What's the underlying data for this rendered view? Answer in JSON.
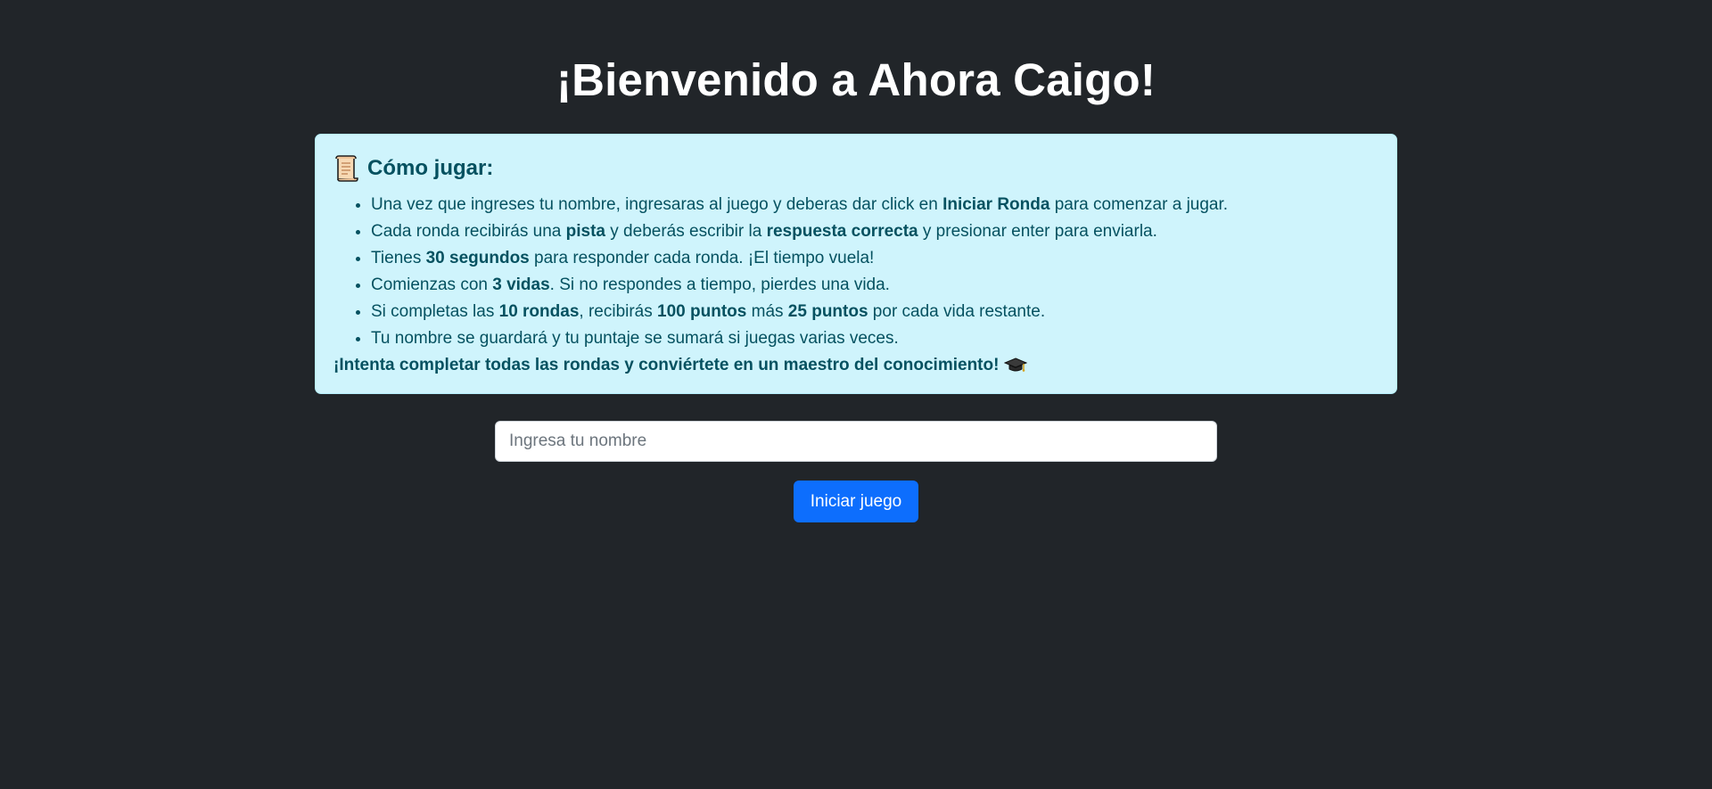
{
  "header": {
    "title": "¡Bienvenido a Ahora Caigo!"
  },
  "instructions": {
    "icon": "scroll-icon",
    "title": "Cómo jugar:",
    "rules": [
      [
        {
          "text": "Una vez que ingreses tu nombre, ingresaras al juego y deberas dar click en ",
          "bold": false
        },
        {
          "text": "Iniciar Ronda",
          "bold": true
        },
        {
          "text": " para comenzar a jugar.",
          "bold": false
        }
      ],
      [
        {
          "text": "Cada ronda recibirás una ",
          "bold": false
        },
        {
          "text": "pista",
          "bold": true
        },
        {
          "text": " y deberás escribir la ",
          "bold": false
        },
        {
          "text": "respuesta correcta",
          "bold": true
        },
        {
          "text": " y presionar enter para enviarla.",
          "bold": false
        }
      ],
      [
        {
          "text": "Tienes ",
          "bold": false
        },
        {
          "text": "30 segundos",
          "bold": true
        },
        {
          "text": " para responder cada ronda. ¡El tiempo vuela!",
          "bold": false
        }
      ],
      [
        {
          "text": "Comienzas con ",
          "bold": false
        },
        {
          "text": "3 vidas",
          "bold": true
        },
        {
          "text": ". Si no respondes a tiempo, pierdes una vida.",
          "bold": false
        }
      ],
      [
        {
          "text": "Si completas las ",
          "bold": false
        },
        {
          "text": "10 rondas",
          "bold": true
        },
        {
          "text": ", recibirás ",
          "bold": false
        },
        {
          "text": "100 puntos",
          "bold": true
        },
        {
          "text": " más ",
          "bold": false
        },
        {
          "text": "25 puntos",
          "bold": true
        },
        {
          "text": " por cada vida restante.",
          "bold": false
        }
      ],
      [
        {
          "text": "Tu nombre se guardará y tu puntaje se sumará si juegas varias veces.",
          "bold": false
        }
      ]
    ],
    "closing": "¡Intenta completar todas las rondas y conviértete en un maestro del conocimiento!",
    "closing_icon": "graduation-cap-icon"
  },
  "form": {
    "name_placeholder": "Ingresa tu nombre",
    "name_value": "",
    "start_label": "Iniciar juego"
  },
  "colors": {
    "background": "#212529",
    "info_bg": "#cff4fc",
    "info_text": "#055160",
    "primary": "#0d6efd"
  }
}
